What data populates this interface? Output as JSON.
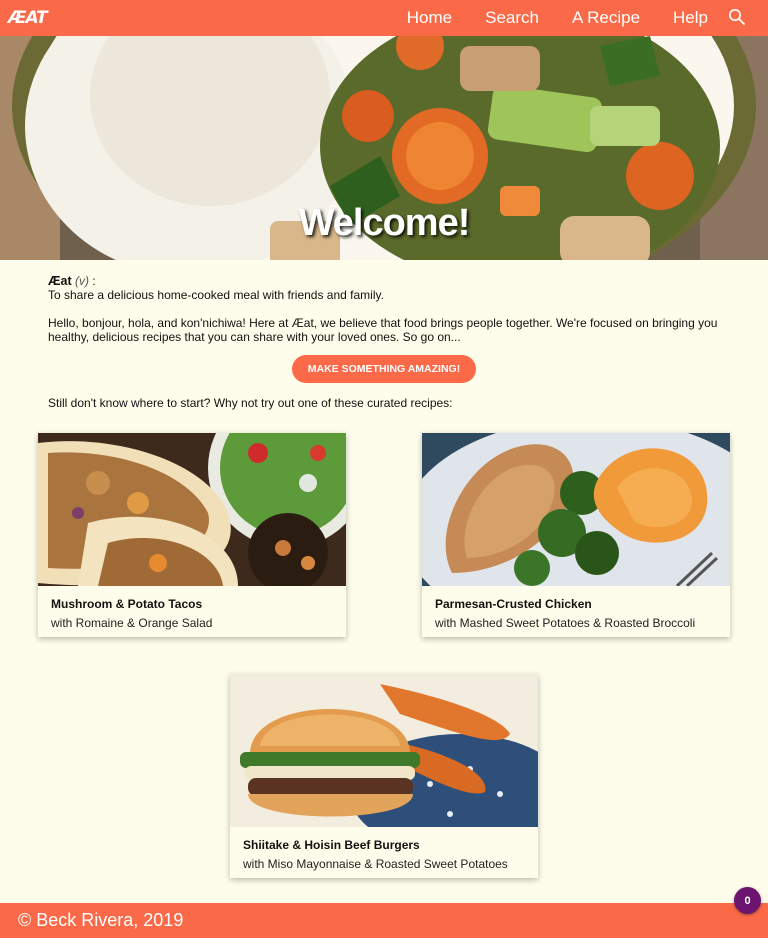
{
  "nav": {
    "logo": "ÆAT",
    "links": [
      "Home",
      "Search",
      "A Recipe",
      "Help"
    ],
    "search_icon": "search-icon"
  },
  "hero": {
    "title": "Welcome!"
  },
  "definition": {
    "word": "Æat",
    "pos": "(v)",
    "colon": " :",
    "meaning": "To share a delicious home-cooked meal with friends and family."
  },
  "intro": "Hello, bonjour, hola, and kon'nichiwa! Here at Æat, we believe that food brings people together. We're focused on bringing you healthy, delicious recipes that you can share with your loved ones. So go on...",
  "cta_label": "MAKE SOMETHING AMAZING!",
  "curated_text": "Still don't know where to start? Why not try out one of these curated recipes:",
  "recipes": [
    {
      "title": "Mushroom & Potato Tacos",
      "subtitle": "with Romaine & Orange Salad"
    },
    {
      "title": "Parmesan-Crusted Chicken",
      "subtitle": "with Mashed Sweet Potatoes & Roasted Broccoli"
    },
    {
      "title": "Shiitake & Hoisin Beef Burgers",
      "subtitle": "with Miso Mayonnaise & Roasted Sweet Potatoes"
    }
  ],
  "footer": {
    "text": "© Beck Rivera, 2019"
  },
  "badge": "0",
  "colors": {
    "brand": "#fb6a48",
    "background": "#fefdeb",
    "badge": "#6b1470"
  }
}
